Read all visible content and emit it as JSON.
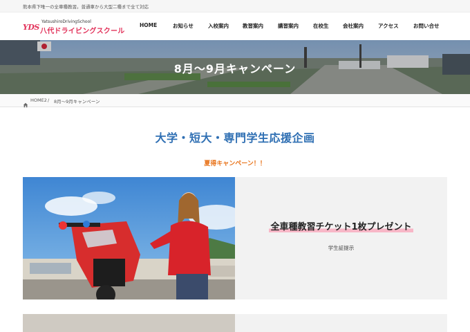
{
  "topbar": {
    "tagline": "熊本県下唯一の全車種教習。普通車から大型二種まで全て対応"
  },
  "logo": {
    "mark": "YDS",
    "en": "YatsushiroDrivingSchool",
    "jp": "八代ドライビングスクール"
  },
  "nav": [
    {
      "label": "HOME"
    },
    {
      "label": "お知らせ"
    },
    {
      "label": "入校案内"
    },
    {
      "label": "教習案内"
    },
    {
      "label": "講習案内"
    },
    {
      "label": "在校生"
    },
    {
      "label": "会社案内"
    },
    {
      "label": "アクセス"
    },
    {
      "label": "お問い合せ"
    }
  ],
  "hero": {
    "title": "8月～9月キャンペーン"
  },
  "breadcrumb": {
    "home": "HOME2",
    "separator": "/",
    "current": "8月～9月キャンペーン"
  },
  "main": {
    "heading": "大学・短大・専門学生応援企画",
    "subheading": "夏得キャンペーン！！",
    "campaign": {
      "title": "全車種教習チケット1枚プレゼント",
      "note": "学生証提示"
    }
  },
  "colors": {
    "brand": "#e2325a",
    "heading": "#2f6fb3",
    "accent": "#e8731a",
    "highlight": "#f8b7c7"
  }
}
